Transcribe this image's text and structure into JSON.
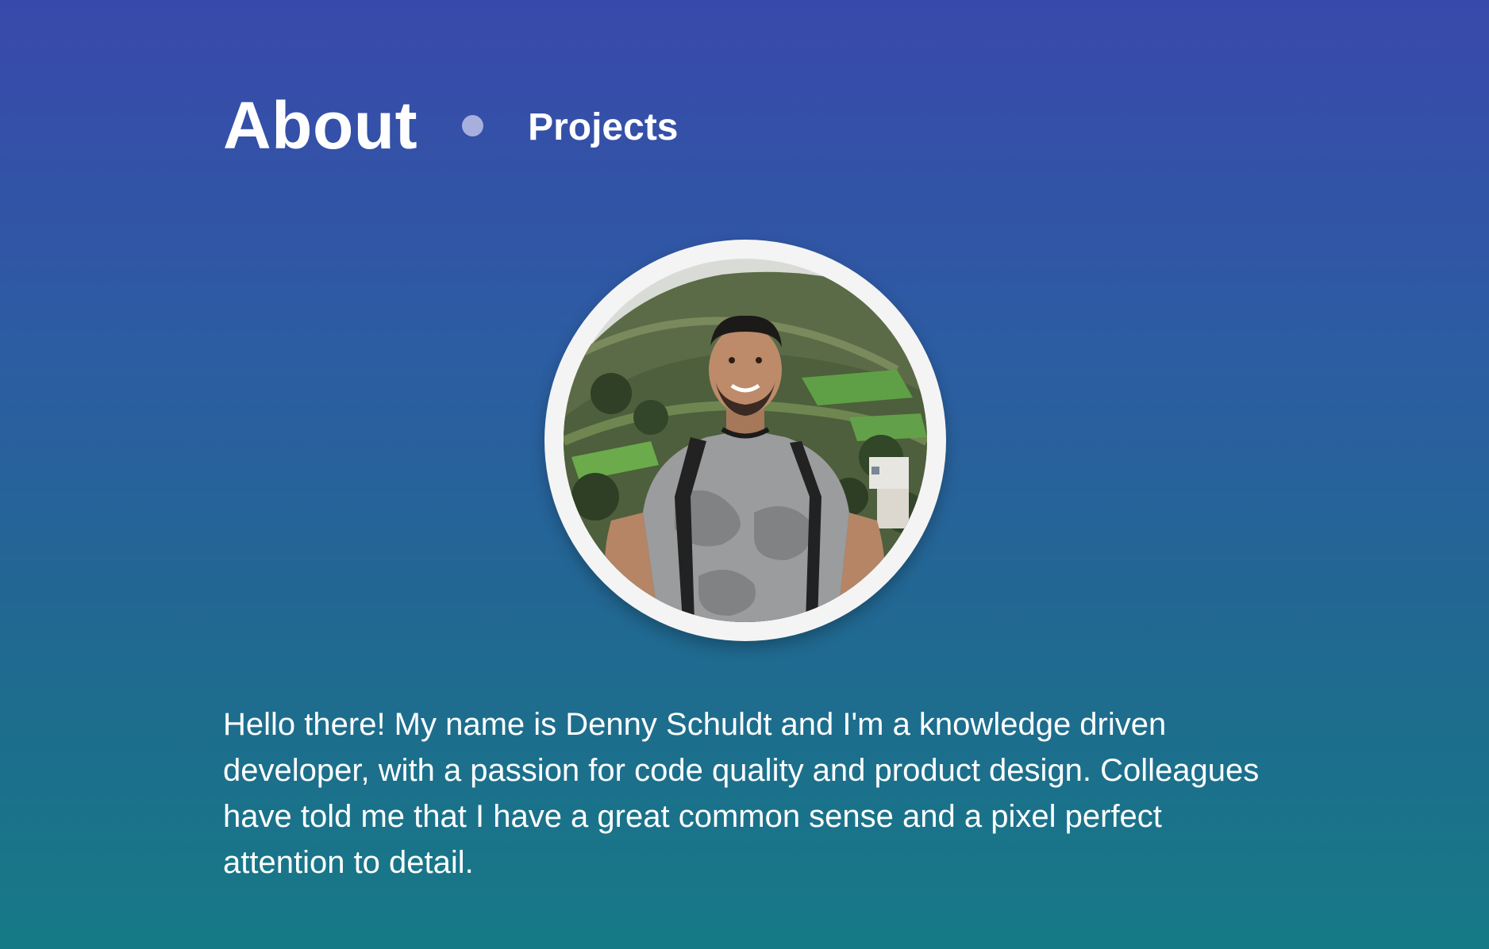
{
  "nav": {
    "about_label": "About",
    "projects_label": "Projects"
  },
  "profile": {
    "bio": "Hello there! My name is Denny Schuldt and I'm a knowledge driven developer, with a passion for code quality and product design. Colleagues have told me that I have a great common sense and a pixel perfect attention to detail."
  },
  "colors": {
    "gradient_top": "#3949ab",
    "gradient_bottom": "#167a86",
    "dot": "#a7b0dd",
    "ring": "#f4f4f4"
  }
}
